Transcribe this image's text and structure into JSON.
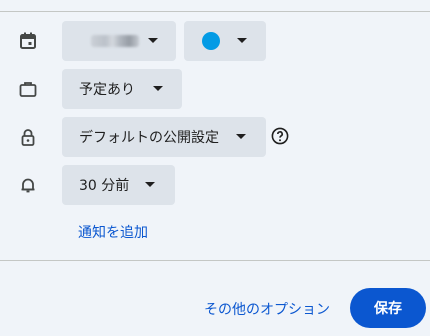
{
  "calendar_row": {
    "calendar_icon": "calendar-icon",
    "calendar_name_obscured": true,
    "color_value": "#039be5"
  },
  "availability_row": {
    "icon": "briefcase-icon",
    "label": "予定あり"
  },
  "visibility_row": {
    "icon": "lock-icon",
    "label": "デフォルトの公開設定",
    "help_icon": "help-circle-icon"
  },
  "notification_row": {
    "icon": "bell-icon",
    "label": "30 分前",
    "add_link": "通知を追加"
  },
  "footer": {
    "more_options": "その他のオプション",
    "save": "保存"
  },
  "colors": {
    "accent": "#0b57d0",
    "chip_bg": "#dde3ea",
    "page_bg": "#f0f4f9"
  }
}
